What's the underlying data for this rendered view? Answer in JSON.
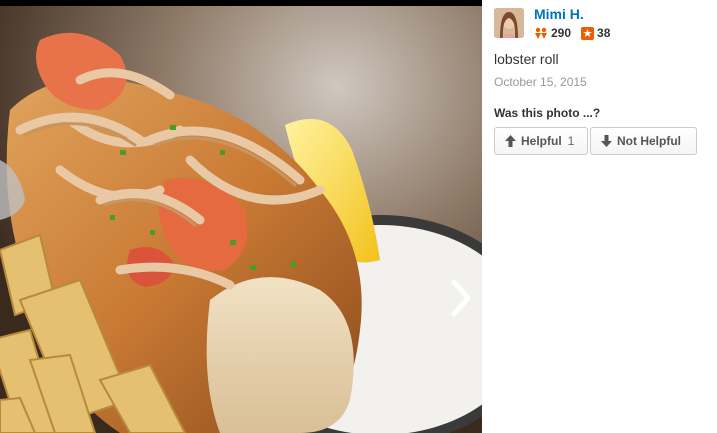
{
  "photo": {
    "subject_icon": "food-photo",
    "next_icon": "chevron-right-icon"
  },
  "user": {
    "name": "Mimi H.",
    "friends_count": "290",
    "reviews_count": "38",
    "friends_icon": "friends-icon",
    "reviews_icon": "star-icon"
  },
  "caption": "lobster roll",
  "date": "October 15, 2015",
  "feedback": {
    "question": "Was this photo ...?",
    "helpful_label": "Helpful",
    "helpful_count": "1",
    "not_helpful_label": "Not Helpful"
  },
  "colors": {
    "link": "#0073bb",
    "friends": "#f15c00",
    "reviews": "#f15c00"
  }
}
